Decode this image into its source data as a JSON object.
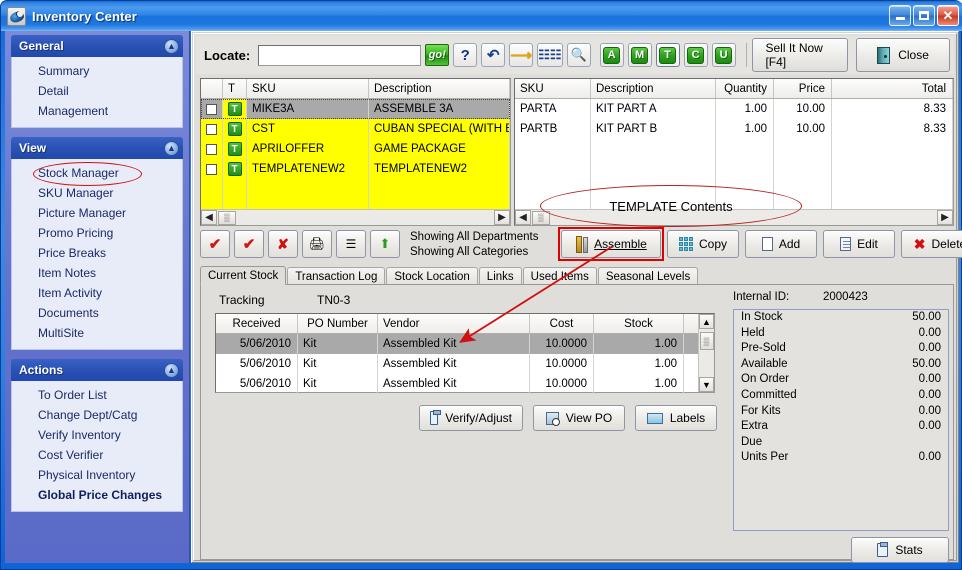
{
  "window": {
    "title": "Inventory Center",
    "app_icon": "inventory-app-icon",
    "controls": {
      "minimize": "minimize",
      "maximize": "maximize",
      "close": "close"
    }
  },
  "sidebar": {
    "groups": [
      {
        "title": "General",
        "collapse_icon": "chevron-up-icon",
        "items": [
          {
            "label": "Summary"
          },
          {
            "label": "Detail"
          },
          {
            "label": "Management"
          }
        ]
      },
      {
        "title": "View",
        "collapse_icon": "chevron-up-icon",
        "items": [
          {
            "label": "Stock Manager",
            "highlighted": true
          },
          {
            "label": "SKU Manager"
          },
          {
            "label": "Picture Manager"
          },
          {
            "label": "Promo Pricing"
          },
          {
            "label": "Price Breaks"
          },
          {
            "label": "Item Notes"
          },
          {
            "label": "Item Activity"
          },
          {
            "label": "Documents"
          },
          {
            "label": "MultiSite"
          }
        ]
      },
      {
        "title": "Actions",
        "collapse_icon": "chevron-up-icon",
        "items": [
          {
            "label": "To Order List"
          },
          {
            "label": "Change Dept/Catg"
          },
          {
            "label": "Verify Inventory"
          },
          {
            "label": "Cost Verifier"
          },
          {
            "label": "Physical Inventory"
          },
          {
            "label": "Global Price Changes",
            "bold": true
          }
        ]
      }
    ]
  },
  "toolbar": {
    "locate_label": "Locate:",
    "locate_value": "",
    "locate_placeholder": "",
    "go_label": "go!",
    "icons": [
      {
        "name": "help-icon",
        "glyph": "?"
      },
      {
        "name": "refresh-icon",
        "glyph": "↺"
      },
      {
        "name": "jump-icon",
        "glyph": "↖"
      },
      {
        "name": "binoculars-icon",
        "glyph": "♋"
      },
      {
        "name": "preview-icon",
        "glyph": "⌕"
      }
    ],
    "letter_buttons": [
      {
        "label": "A",
        "active": false
      },
      {
        "label": "M",
        "active": false
      },
      {
        "label": "T",
        "active": true
      },
      {
        "label": "C",
        "active": false
      },
      {
        "label": "U",
        "active": false
      }
    ],
    "sell_now_label": "Sell It Now [F4]",
    "close_label": "Close",
    "close_icon": "exit-door-icon"
  },
  "item_grid": {
    "columns": [
      "",
      "T",
      "SKU",
      "Description"
    ],
    "rows": [
      {
        "checked": false,
        "type": "T",
        "sku": "MIKE3A",
        "description": "ASSEMBLE 3A",
        "selected": true
      },
      {
        "checked": false,
        "type": "T",
        "sku": "CST",
        "description": "CUBAN SPECIAL (WITH EX",
        "selected": false
      },
      {
        "checked": false,
        "type": "T",
        "sku": "APRILOFFER",
        "description": "GAME PACKAGE",
        "selected": false
      },
      {
        "checked": false,
        "type": "T",
        "sku": "TEMPLATENEW2",
        "description": "TEMPLATENEW2",
        "selected": false
      }
    ]
  },
  "contents_grid": {
    "columns": [
      "SKU",
      "Description",
      "Quantity",
      "Price",
      "Total"
    ],
    "rows": [
      {
        "sku": "PARTA",
        "description": "KIT PART A",
        "quantity": "1.00",
        "price": "10.00",
        "total": "8.33"
      },
      {
        "sku": "PARTB",
        "description": "KIT PART B",
        "quantity": "1.00",
        "price": "10.00",
        "total": "8.33"
      }
    ],
    "annotation": "TEMPLATE Contents"
  },
  "action_row": {
    "small_buttons": [
      {
        "name": "check-all-icon",
        "glyph": "✓"
      },
      {
        "name": "check-all-a-icon",
        "glyph": "✓"
      },
      {
        "name": "uncheck-all-icon",
        "glyph": "✗"
      },
      {
        "name": "print-icon",
        "glyph": "⎙"
      },
      {
        "name": "list-icon",
        "glyph": "☰"
      },
      {
        "name": "export-up-icon",
        "glyph": "⬆"
      }
    ],
    "status_line1": "Showing All Departments",
    "status_line2": "Showing All Categories",
    "buttons": [
      {
        "label": "Assemble",
        "icon": "assemble-icon",
        "highlighted": true
      },
      {
        "label": "Copy",
        "icon": "copy-grid-icon"
      },
      {
        "label": "Add",
        "icon": "add-page-icon"
      },
      {
        "label": "Edit",
        "icon": "edit-page-icon"
      },
      {
        "label": "Delete",
        "icon": "delete-x-icon"
      }
    ]
  },
  "tabs": [
    {
      "label": "Current Stock",
      "active": true
    },
    {
      "label": "Transaction Log",
      "active": false
    },
    {
      "label": "Stock Location",
      "active": false
    },
    {
      "label": "Links",
      "active": false
    },
    {
      "label": "Used Items",
      "active": false
    },
    {
      "label": "Seasonal Levels",
      "active": false
    }
  ],
  "current_stock": {
    "tracking_label": "Tracking",
    "tracking_value": "TN0-3",
    "internal_id_label": "Internal ID:",
    "internal_id_value": "2000423",
    "columns": [
      "Received",
      "PO Number",
      "Vendor",
      "Cost",
      "Stock"
    ],
    "rows": [
      {
        "received": "5/06/2010",
        "po_number": "Kit",
        "vendor": "Assembled Kit",
        "cost": "10.0000",
        "stock": "1.00",
        "selected": true
      },
      {
        "received": "5/06/2010",
        "po_number": "Kit",
        "vendor": "Assembled Kit",
        "cost": "10.0000",
        "stock": "1.00",
        "selected": false
      },
      {
        "received": "5/06/2010",
        "po_number": "Kit",
        "vendor": "Assembled Kit",
        "cost": "10.0000",
        "stock": "1.00",
        "selected": false
      }
    ],
    "buttons": [
      {
        "label": "Verify/Adjust",
        "icon": "clipboard-icon"
      },
      {
        "label": "View PO",
        "icon": "view-po-icon"
      },
      {
        "label": "Labels",
        "icon": "labels-icon"
      }
    ]
  },
  "stats": {
    "rows": [
      {
        "label": "In Stock",
        "value": "50.00"
      },
      {
        "label": "Held",
        "value": "0.00"
      },
      {
        "label": "Pre-Sold",
        "value": "0.00"
      },
      {
        "label": "Available",
        "value": "50.00"
      },
      {
        "label": "On Order",
        "value": "0.00"
      },
      {
        "label": "Committed",
        "value": "0.00"
      },
      {
        "label": "For Kits",
        "value": "0.00"
      },
      {
        "label": "Extra",
        "value": "0.00"
      },
      {
        "label": "Due",
        "value": ""
      },
      {
        "label": "Units Per",
        "value": "0.00"
      }
    ],
    "stats_button_label": "Stats",
    "stats_button_icon": "clipboard-icon"
  },
  "colors": {
    "titlebar_blue": "#1a6fe0",
    "sidebar_blue": "#6272cc",
    "group_header_blue": "#2a51b4",
    "row_highlight_yellow": "#ffff00",
    "selection_gray": "#a9a9a9",
    "annotation_red": "#d01010",
    "badge_green": "#2fa31d"
  }
}
